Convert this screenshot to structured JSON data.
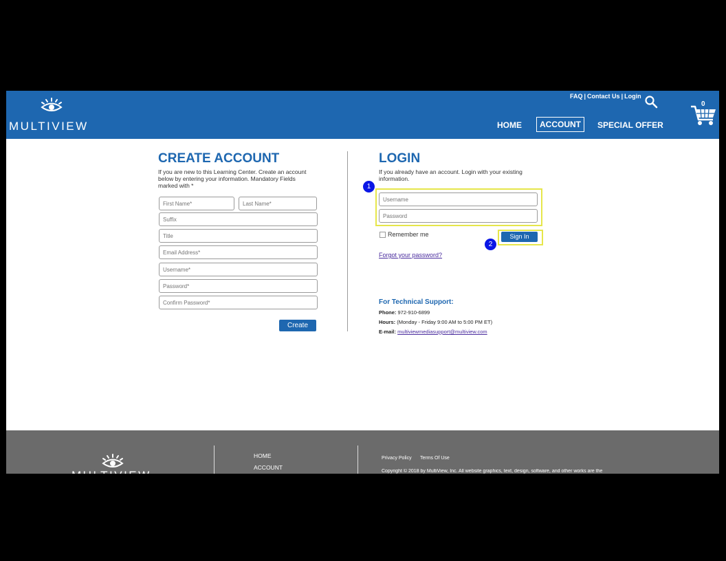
{
  "header": {
    "brand": "MULTIVIEW",
    "top_links": [
      "FAQ",
      "Contact Us",
      "Login"
    ],
    "separator": "|",
    "cart_count": "0",
    "nav": {
      "home": "HOME",
      "account": "ACCOUNT",
      "special_offer": "SPECIAL OFFER"
    },
    "colors": {
      "header_bg": "#1e67b0",
      "highlight": "#e6e64a",
      "step_marker": "#0a16e6"
    }
  },
  "create_account": {
    "title": "CREATE ACCOUNT",
    "intro": "If you are new to this Learning Center. Create an account below by entering your information. Mandatory Fields marked with *",
    "fields": {
      "first_name": "First Name*",
      "last_name": "Last Name*",
      "suffix": "Suffix",
      "title": "Title",
      "email": "Email Address*",
      "username": "Username*",
      "password": "Password*",
      "confirm_password": "Confirm Password*"
    },
    "create_label": "Create"
  },
  "login": {
    "title": "LOGIN",
    "intro": "If you already have an account. Login with your existing information.",
    "username_placeholder": "Username",
    "password_placeholder": "Password",
    "remember_label": "Remember me",
    "sign_in_label": "Sign In",
    "forgot_label": "Forgot your password?",
    "step_markers": [
      "1",
      "2"
    ]
  },
  "support": {
    "title": "For Technical Support:",
    "phone_label": "Phone:",
    "phone": "972-910-6899",
    "hours_label": "Hours:",
    "hours": "(Monday - Friday 9:00 AM to 5:00 PM ET)",
    "email_label": "E-mail:",
    "email": "multiviewmediasupport@multiview.com"
  },
  "footer": {
    "links": [
      "HOME",
      "ACCOUNT"
    ],
    "legal_links": [
      "Privacy Policy",
      "Terms Of Use"
    ],
    "copyright": "Copyright © 2018 by MultiView, Inc. All website graphics, text, design, software, and other works are the"
  }
}
